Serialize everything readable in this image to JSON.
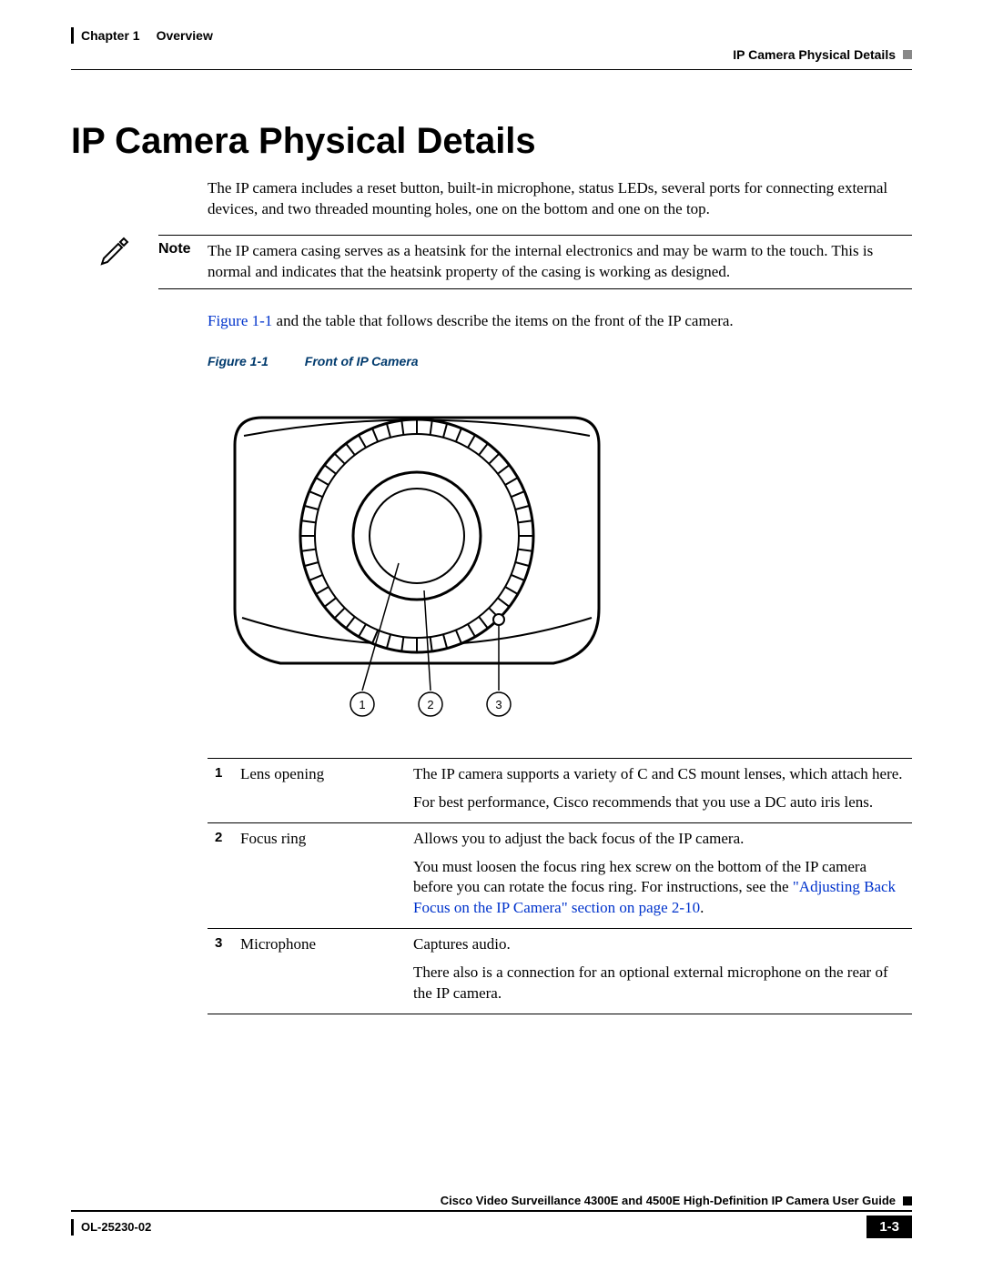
{
  "header": {
    "chapter": "Chapter 1",
    "section": "Overview",
    "right": "IP Camera Physical Details"
  },
  "title": "IP Camera Physical Details",
  "intro": "The IP camera includes a reset button, built-in microphone, status LEDs, several ports for connecting external devices, and two threaded mounting holes, one on the bottom and one on the top.",
  "note": {
    "label": "Note",
    "text": "The IP camera casing serves as a heatsink for the internal electronics and may be warm to the touch. This is normal and indicates that the heatsink property of the casing is working as designed."
  },
  "figref": {
    "link": "Figure 1-1",
    "rest": " and the table that follows describe the items on the front of the IP camera."
  },
  "figure": {
    "label": "Figure 1-1",
    "title": "Front of IP Camera",
    "callouts": [
      "1",
      "2",
      "3"
    ]
  },
  "table": [
    {
      "num": "1",
      "name": "Lens opening",
      "desc": [
        "The IP camera supports a variety of C and CS mount lenses, which attach here.",
        "For best performance, Cisco recommends that you use a DC auto iris lens."
      ]
    },
    {
      "num": "2",
      "name": "Focus ring",
      "desc": [
        "Allows you to adjust the back focus of the IP camera.",
        "You must loosen the focus ring hex screw on the bottom of the IP camera before you can rotate the focus ring. For instructions, see the <span class=\"link\">\"Adjusting Back Focus on the IP Camera\" section on page 2-10</span>."
      ]
    },
    {
      "num": "3",
      "name": "Microphone",
      "desc": [
        "Captures audio.",
        "There also is a connection for an optional external microphone on the rear of the IP camera."
      ]
    }
  ],
  "footer": {
    "guide": "Cisco Video Surveillance 4300E and 4500E High-Definition IP Camera User Guide",
    "docnum": "OL-25230-02",
    "page": "1-3"
  }
}
